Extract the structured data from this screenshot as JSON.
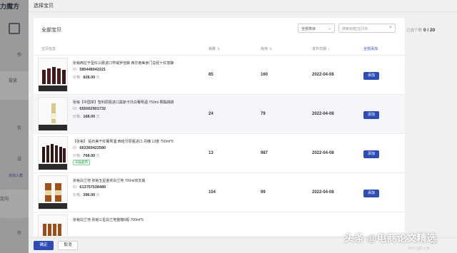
{
  "background": {
    "logo": "力魔方",
    "nav": [
      "作",
      "投放",
      "仪",
      "设",
      "定向",
      "作"
    ],
    "link": "添加人群"
  },
  "modal": {
    "title": "选择宝贝",
    "panel_title": "全部宝贝",
    "category_select": "全部类目",
    "search_placeholder": "搜索标题/宝贝ID",
    "columns": {
      "info": "宝贝信息",
      "sales": "销量",
      "stock": "库存",
      "date": "发布日期",
      "add_all": "全部添加"
    },
    "counter_label": "已选个数",
    "counter_value": "0 / 20",
    "id_label": "ID:",
    "price_label": "价格:",
    "price_unit": "元",
    "add_label": "添加",
    "items": [
      {
        "name": "张裕西拉干型红公爵进口学威罗佳酿 西华南美食门总经十红意酿",
        "id": "585448042221",
        "price": "828.00",
        "sales": "85",
        "stock": "160",
        "date": "2022-04-08",
        "tag": ""
      },
      {
        "name": "张裕【中国举】智利原瓶进口黑斯卡托白葡萄酒 750ml 果酯跳跳",
        "id": "655002901732",
        "price": "168.00",
        "sales": "24",
        "stock": "79",
        "date": "2022-04-08",
        "tag": ""
      },
      {
        "name": "【张裕】 钻石美干红葡萄酒 西班牙原瓶进口 丹魄 12度 750ml*6",
        "id": "663369422580",
        "price": "768.00",
        "sales": "13",
        "stock": "987",
        "date": "2022-04-08",
        "tag": "天猫超市"
      },
      {
        "name": "张裕白兰地 张裕五星金奖白兰地 700ml双支装",
        "id": "613757538489",
        "price": "396.00",
        "sales": "104",
        "stock": "99",
        "date": "2022-04-08",
        "tag": ""
      },
      {
        "name": "张裕白兰地 张裕三星白兰地整箱6瓶 700ml*6",
        "id": "",
        "price": "",
        "sales": "",
        "stock": "",
        "date": "",
        "tag": ""
      }
    ],
    "ok_label": "确定",
    "cancel_label": "取消"
  },
  "watermark": {
    "main": "头条 @电商论文精选",
    "sub": "转到\"设置\"以激",
    "win": "Vir"
  }
}
